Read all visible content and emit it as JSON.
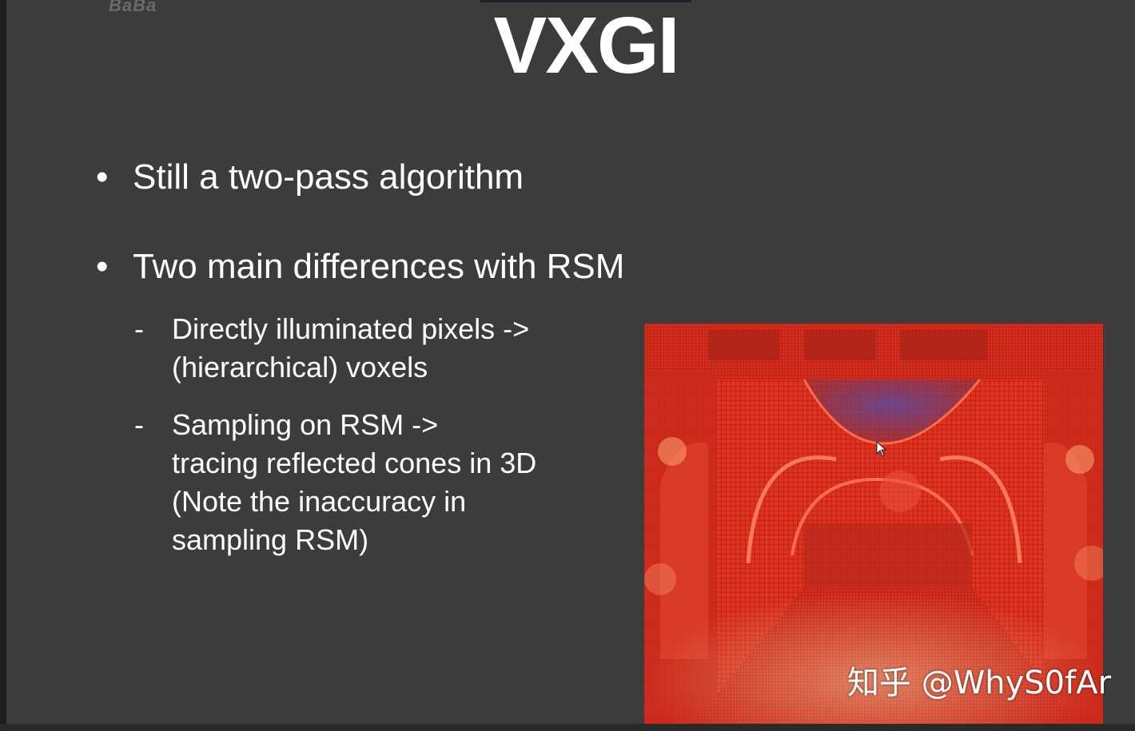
{
  "slide": {
    "title": "VXGI",
    "bullets": [
      {
        "marker": "•",
        "text": "Still a two-pass algorithm"
      },
      {
        "marker": "•",
        "text": "Two main differences with RSM"
      }
    ],
    "subpoints": [
      {
        "marker": "-",
        "lines": [
          "Directly illuminated pixels ->",
          "(hierarchical) voxels"
        ]
      },
      {
        "marker": "-",
        "lines": [
          "Sampling on RSM ->",
          "tracing reflected cones in 3D",
          "(Note the inaccuracy in",
          "sampling RSM)"
        ]
      }
    ],
    "figure": {
      "description_icon": "voxelized-scene-image",
      "dominant_color": "#d8281c"
    },
    "watermark": "知乎 @WhyS0fAr"
  },
  "colors": {
    "background": "#3c3c3c",
    "text": "#ffffff",
    "voxel_red": "#e0301f"
  }
}
